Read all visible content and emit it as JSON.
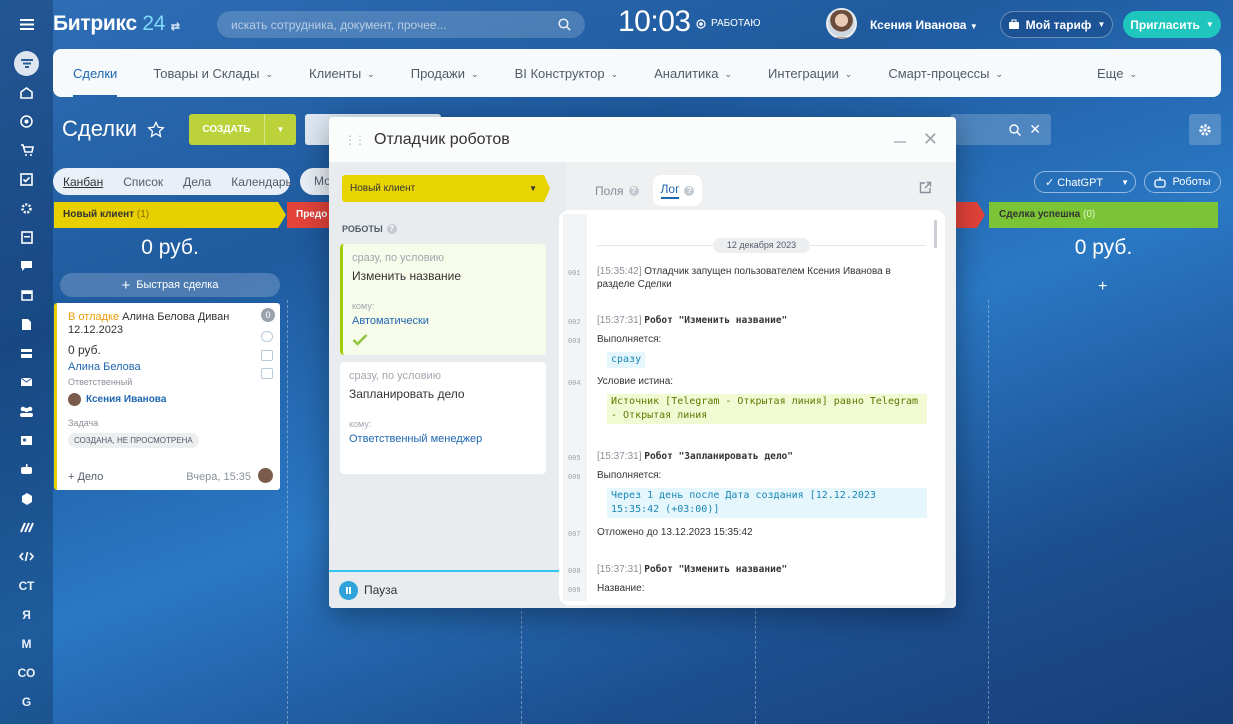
{
  "header": {
    "logo_text": "Битрикс",
    "logo_num": "24",
    "search_placeholder": "искать сотрудника, документ, прочее...",
    "clock": "10:03",
    "work_status": "РАБОТАЮ",
    "user_name": "Ксения Иванова",
    "tariff": "Мой тариф",
    "invite": "Пригласить"
  },
  "rail": {
    "items": [
      "СТ",
      "Я",
      "М",
      "СО",
      "G"
    ]
  },
  "menu": {
    "items": [
      {
        "label": "Сделки",
        "active": true,
        "chev": false
      },
      {
        "label": "Товары и Склады",
        "chev": true
      },
      {
        "label": "Клиенты",
        "chev": true
      },
      {
        "label": "Продажи",
        "chev": true
      },
      {
        "label": "BI Конструктор",
        "chev": true
      },
      {
        "label": "Аналитика",
        "chev": true
      },
      {
        "label": "Интеграции",
        "chev": true
      },
      {
        "label": "Смарт-процессы",
        "chev": true
      }
    ],
    "more": "Еще"
  },
  "toolbar": {
    "title": "Сделки",
    "create": "СОЗДАТЬ",
    "views": [
      "Канбан",
      "Список",
      "Дела",
      "Календарь"
    ],
    "mo": "Мо",
    "chatgpt": "ChatGPT",
    "robots": "Роботы"
  },
  "kanban": {
    "col1": {
      "stage": "Новый клиент",
      "count": "(1)",
      "sum": "0 руб.",
      "quick": "Быстрая сделка"
    },
    "col2": {
      "stage": "Предо"
    },
    "col4": {
      "stage": "Сделка успешна",
      "count": "(0)",
      "sum": "0 руб."
    },
    "card": {
      "debug": "В отладке",
      "title": "Алина Белова Диван 12.12.2023",
      "price": "0 руб.",
      "client": "Алина Белова",
      "resp_label": "Ответственный",
      "resp_name": "Ксения Иванова",
      "task_label": "Задача",
      "badge": "СОЗДАНА, НЕ ПРОСМОТРЕНА",
      "add": "+ Дело",
      "date": "Вчера, 15:35",
      "counter": "0"
    }
  },
  "modal": {
    "title": "Отладчик роботов",
    "stage": "Новый клиент",
    "robots_label": "РОБОТЫ",
    "robots": [
      {
        "cond": "сразу, по условию",
        "name": "Изменить название",
        "whom_label": "кому:",
        "whom": "Автоматически",
        "done": true
      },
      {
        "cond": "сразу, по условию",
        "name": "Запланировать дело",
        "whom_label": "кому:",
        "whom": "Ответственный менеджер",
        "done": false
      }
    ],
    "pause": "Пауза",
    "tabs": {
      "fields": "Поля",
      "log": "Лог"
    },
    "log": {
      "date": "12 декабря 2023",
      "lines": [
        {
          "n": "001",
          "ts": "[15:35:42]",
          "text": "Отладчик запущен пользователем Ксения Иванова в разделе Сделки"
        },
        {
          "n": "002",
          "ts": "[15:37:31]",
          "text": "Робот \"Изменить название\""
        },
        {
          "n": "003",
          "text": "Выполняется:"
        },
        {
          "chip": "сразу"
        },
        {
          "n": "004",
          "text": "Условие истина:"
        },
        {
          "chip": "Источник [Telegram - Открытая линия] равно Telegram - Открытая линия"
        },
        {
          "n": "005",
          "ts": "[15:37:31]",
          "text": "Робот \"Запланировать дело\""
        },
        {
          "n": "006",
          "text": "Выполняется:"
        },
        {
          "chip": "Через 1 день после Дата создания [12.12.2023 15:35:42 (+03:00)]"
        },
        {
          "n": "007",
          "text": "Отложено до 13.12.2023 15:35:42"
        },
        {
          "n": "008",
          "ts": "[15:37:31]",
          "text": "Робот \"Изменить название\""
        },
        {
          "n": "009",
          "text": "Название:"
        }
      ]
    }
  },
  "colors": {
    "accent": "#2067b0",
    "stage_new": "#e8d000",
    "stage_success": "#7bc436",
    "stage_red": "#e2433a",
    "create_btn": "#bbd23a",
    "invite_btn": "#1ec6bd"
  },
  "icons": [
    "menu-icon",
    "filter-icon",
    "home-icon",
    "target-icon",
    "cart-icon",
    "checkbox-icon",
    "gear-icon",
    "search-icon",
    "star-icon",
    "close-icon",
    "external-link-icon",
    "pause-icon",
    "check-icon",
    "phone-icon",
    "mail-icon",
    "chat-icon"
  ]
}
